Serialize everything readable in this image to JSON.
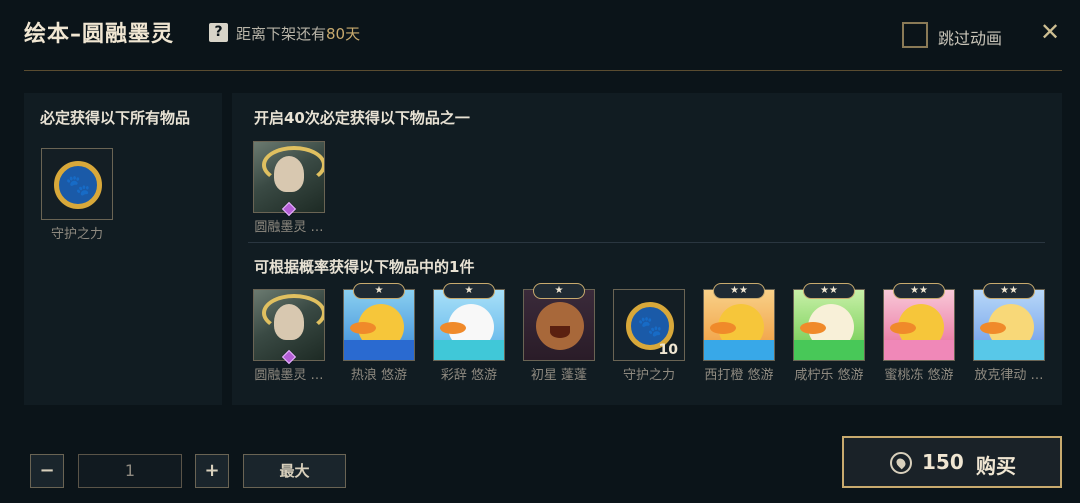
{
  "header": {
    "title": "绘本–圆融墨灵",
    "help_icon": "question-mark-icon",
    "countdown_prefix": "距离下架还有",
    "countdown_days": "80天",
    "skip_label": "跳过动画",
    "skip_checked": false,
    "close_icon": "close-x-icon",
    "accent_color": "#c8aa6e"
  },
  "guaranteed_panel": {
    "title": "必定获得以下所有物品",
    "items": [
      {
        "label": "守护之力",
        "art": "paw-emblem"
      }
    ]
  },
  "milestone_panel": {
    "title": "开启40次必定获得以下物品之一",
    "items": [
      {
        "label": "圆融墨灵 …",
        "art": "ink-spirit-character"
      }
    ]
  },
  "probability_panel": {
    "title": "可根据概率获得以下物品中的1件",
    "items": [
      {
        "label": "圆融墨灵 …",
        "art": "ink-spirit-character",
        "stars": "",
        "count": ""
      },
      {
        "label": "热浪 悠游",
        "art": "duck-heatwave",
        "stars": "★",
        "count": ""
      },
      {
        "label": "彩辞 悠游",
        "art": "duck-colorful",
        "stars": "★",
        "count": ""
      },
      {
        "label": "初星 蓬蓬",
        "art": "bear-firststar",
        "stars": "★",
        "count": ""
      },
      {
        "label": "守护之力",
        "art": "paw-emblem",
        "stars": "",
        "count": "10"
      },
      {
        "label": "西打橙 悠游",
        "art": "duck-orange",
        "stars": "★★",
        "count": ""
      },
      {
        "label": "咸柠乐 悠游",
        "art": "duck-lime",
        "stars": "★★",
        "count": ""
      },
      {
        "label": "蜜桃冻 悠游",
        "art": "duck-peach",
        "stars": "★★",
        "count": ""
      },
      {
        "label": "放克律动 …",
        "art": "duck-funk",
        "stars": "★★",
        "count": ""
      }
    ]
  },
  "purchase": {
    "minus_label": "−",
    "quantity": "1",
    "plus_label": "+",
    "max_label": "最大",
    "coin_icon": "currency-coin-icon",
    "price": "150",
    "buy_label": "购买"
  }
}
